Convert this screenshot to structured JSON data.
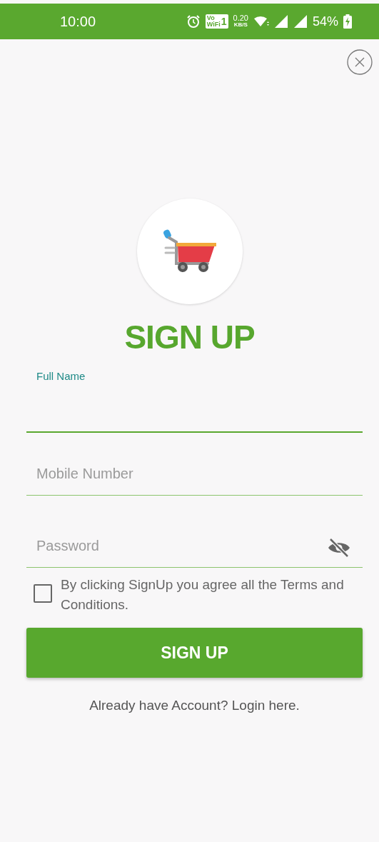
{
  "status_bar": {
    "time": "10:00",
    "volte": {
      "top": "Vo",
      "bottom": "WiFi",
      "sim": "1"
    },
    "speed": {
      "value": "0.20",
      "unit": "KB/S"
    },
    "battery": "54%"
  },
  "title": "SIGN UP",
  "fields": [
    {
      "kind": "text",
      "label": "Full Name",
      "focused": true
    },
    {
      "kind": "text",
      "placeholder": "Mobile Number",
      "focused": false
    },
    {
      "kind": "password",
      "placeholder": "Password",
      "focused": false
    }
  ],
  "terms": {
    "text": "By clicking SignUp you agree all the Terms and Conditions.",
    "checked": false
  },
  "button": "SIGN UP",
  "login_link": "Already have Account? Login here."
}
